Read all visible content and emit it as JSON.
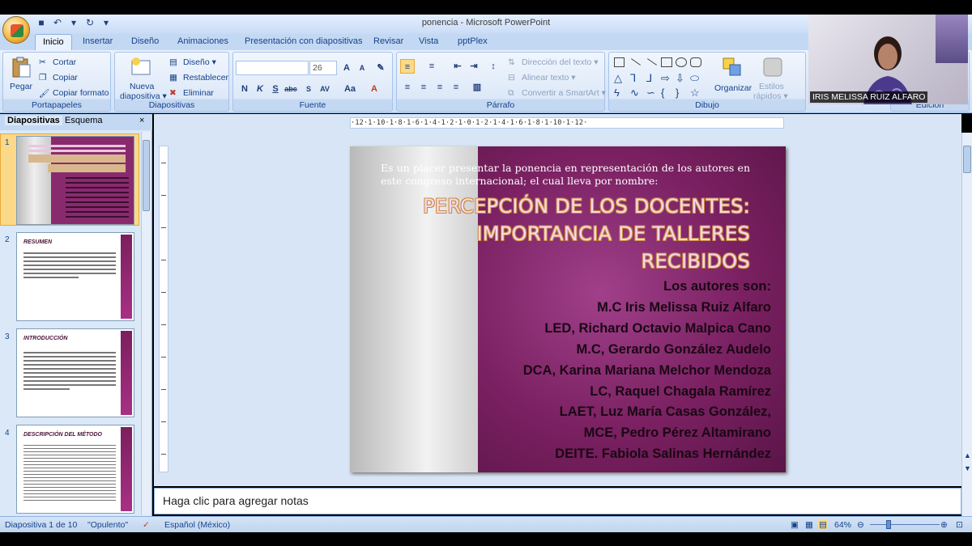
{
  "window": {
    "title": "ponencia - Microsoft PowerPoint"
  },
  "ribbon": {
    "tabs": [
      "Inicio",
      "Insertar",
      "Diseño",
      "Animaciones",
      "Presentación con diapositivas",
      "Revisar",
      "Vista",
      "pptPlex"
    ],
    "clipboard": {
      "paste": "Pegar",
      "cut": "Cortar",
      "copy": "Copiar",
      "format_painter": "Copiar formato",
      "label": "Portapapeles"
    },
    "slides": {
      "new_slide_1": "Nueva",
      "new_slide_2": "diapositiva",
      "layout": "Diseño",
      "reset": "Restablecer",
      "delete": "Eliminar",
      "label": "Diapositivas"
    },
    "font": {
      "size": "26",
      "label": "Fuente"
    },
    "paragraph": {
      "text_direction": "Dirección del texto",
      "align_text": "Alinear texto",
      "smartart": "Convertir a SmartArt",
      "label": "Párrafo"
    },
    "drawing": {
      "arrange": "Organizar",
      "styles_1": "Estilos",
      "styles_2": "rápidos",
      "label": "Dibujo"
    },
    "editing": {
      "label": "Edición"
    }
  },
  "panel": {
    "tabs": [
      "Diapositivas",
      "Esquema"
    ],
    "thumbs": [
      {
        "num": "1"
      },
      {
        "num": "2",
        "title": "RESUMEN"
      },
      {
        "num": "3",
        "title": "INTRODUCCIÓN"
      },
      {
        "num": "4",
        "title": "DESCRIPCIÓN DEL MÉTODO"
      }
    ]
  },
  "ruler": {
    "marks": "·12·1·10·1·8·1·6·1·4·1·2·1·0·1·2·1·4·1·6·1·8·1·10·1·12·"
  },
  "slide": {
    "intro": "Es un placer presentar la ponencia en representación de los autores en este congreso internacional; el cual lleva por nombre:",
    "title_1": "PERCEPCIÓN DE LOS DOCENTES:",
    "title_2": "IMPORTANCIA DE TALLERES",
    "title_3": "RECIBIDOS",
    "authors": [
      "Los autores son:",
      "M.C Iris Melissa Ruiz Alfaro",
      "LED, Richard Octavio Malpica Cano",
      "M.C, Gerardo González Audelo",
      "DCA, Karina Mariana Melchor Mendoza",
      "LC, Raquel Chagala Ramírez",
      "LAET, Luz María Casas González,",
      "MCE, Pedro Pérez Altamirano",
      "DEITE. Fabiola Salinas Hernández"
    ]
  },
  "notes": {
    "placeholder": "Haga clic para agregar notas"
  },
  "status": {
    "slide_count": "Diapositiva 1 de 10",
    "theme": "\"Opulento\"",
    "language": "Español (México)",
    "zoom": "64%"
  },
  "webcam": {
    "name": "IRIS MELISSA RUIZ ALFARO"
  }
}
